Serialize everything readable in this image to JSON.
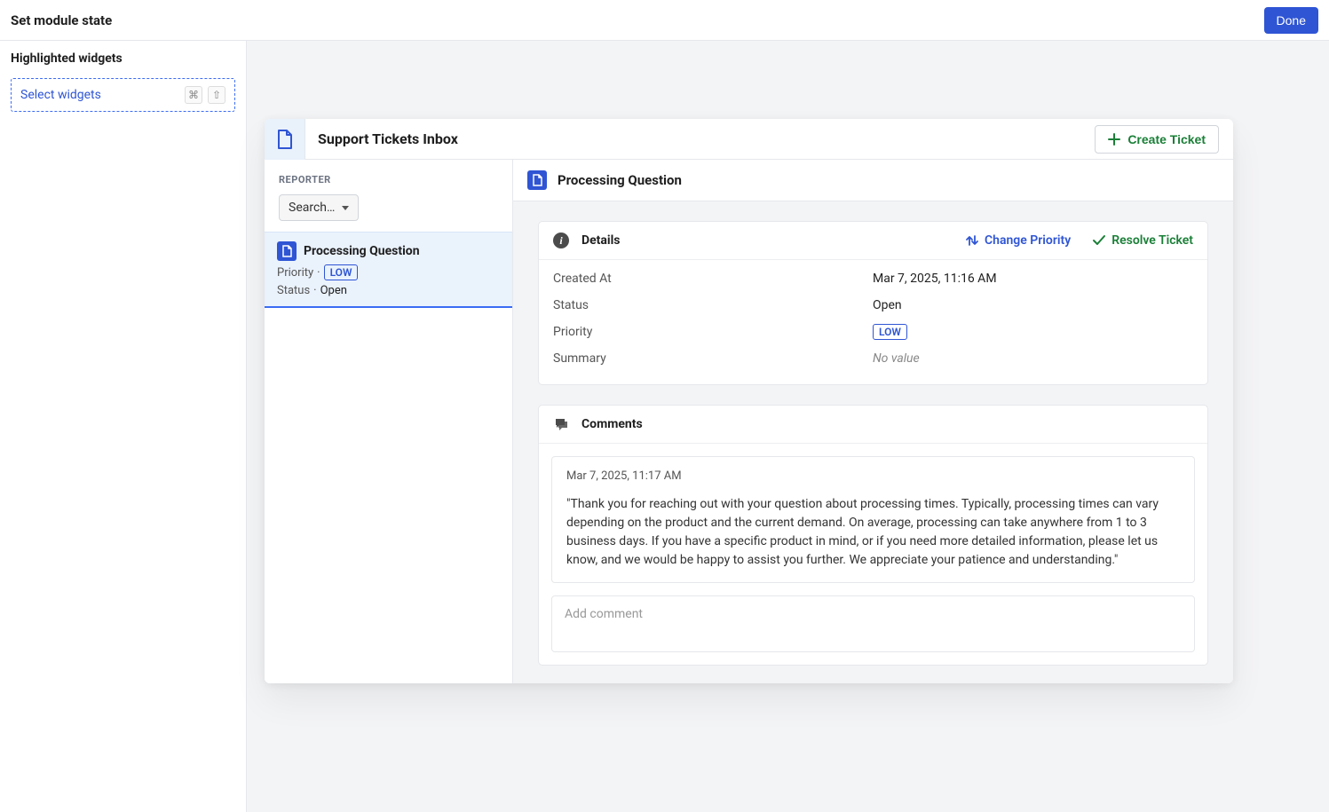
{
  "topbar": {
    "title": "Set module state",
    "done_label": "Done"
  },
  "left_panel": {
    "heading": "Highlighted widgets",
    "select_label": "Select widgets",
    "shortcut_cmd": "⌘",
    "shortcut_shift": "⇧"
  },
  "app": {
    "title": "Support Tickets Inbox",
    "create_button": "Create Ticket"
  },
  "ticket_list": {
    "reporter_label": "REPORTER",
    "search_label": "Search…",
    "items": [
      {
        "title": "Processing Question",
        "priority_label": "Priority",
        "priority_badge": "LOW",
        "status_label": "Status",
        "status_value": "Open"
      }
    ]
  },
  "detail": {
    "title": "Processing Question",
    "details_heading": "Details",
    "actions": {
      "change_priority": "Change Priority",
      "resolve_ticket": "Resolve Ticket"
    },
    "fields": {
      "created_at_label": "Created At",
      "created_at_value": "Mar 7, 2025, 11:16 AM",
      "status_label": "Status",
      "status_value": "Open",
      "priority_label": "Priority",
      "priority_badge": "LOW",
      "summary_label": "Summary",
      "summary_value": "No value"
    },
    "comments_heading": "Comments",
    "comments": [
      {
        "timestamp": "Mar 7, 2025, 11:17 AM",
        "body": "\"Thank you for reaching out with your question about processing times. Typically, processing times can vary depending on the product and the current demand. On average, processing can take anywhere from 1 to 3 business days. If you have a specific product in mind, or if you need more detailed information, please let us know, and we would be happy to assist you further. We appreciate your patience and understanding.\""
      }
    ],
    "add_comment_placeholder": "Add comment"
  }
}
